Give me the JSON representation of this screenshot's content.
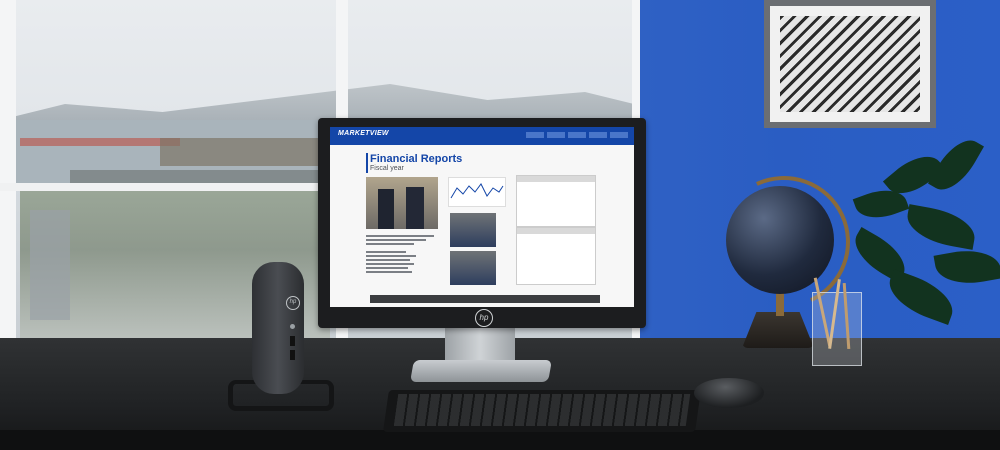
{
  "screen": {
    "brand": "MARKETVIEW",
    "title": "Financial Reports",
    "subtitle": "Fiscal year"
  },
  "monitor": {
    "logo_text": "hp"
  },
  "thin_client": {
    "logo_text": "hp"
  },
  "colors": {
    "wall": "#2b5fc7",
    "screen_header": "#1446a8",
    "desk": "#202224"
  }
}
